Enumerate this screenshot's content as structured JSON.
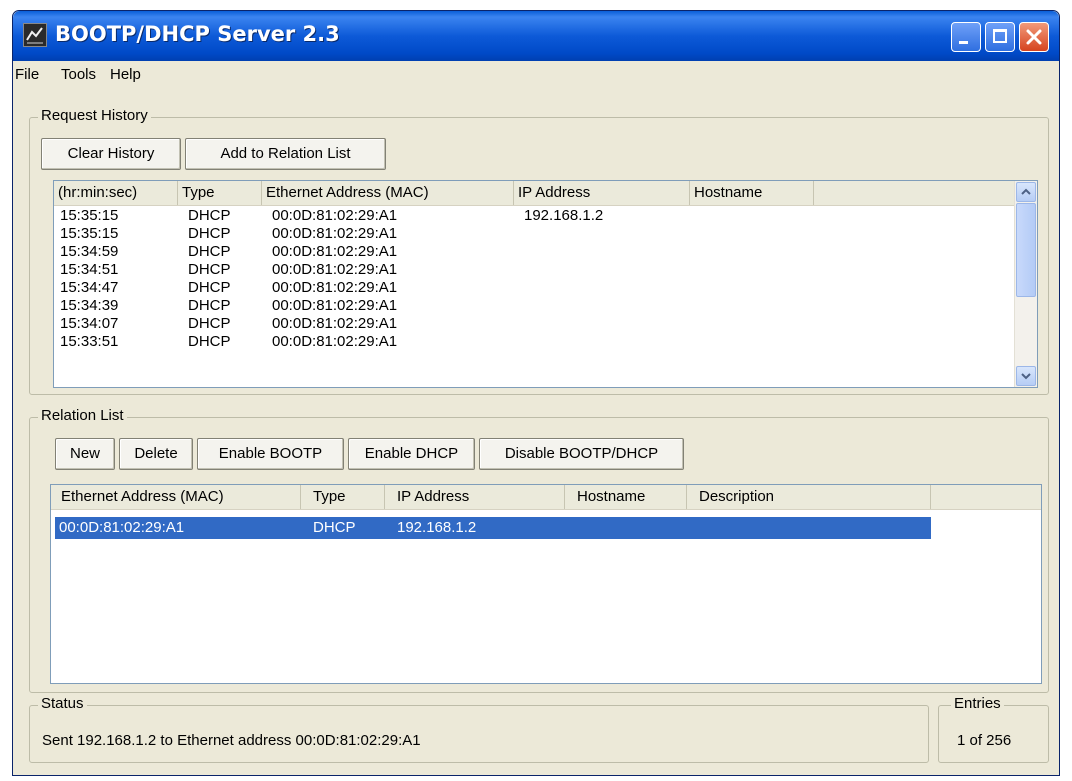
{
  "window": {
    "title": "BOOTP/DHCP Server 2.3"
  },
  "menu": [
    "File",
    "Tools",
    "Help"
  ],
  "request_history": {
    "label": "Request History",
    "buttons": {
      "clear": "Clear History",
      "add": "Add to Relation List"
    },
    "columns": [
      "(hr:min:sec)",
      "Type",
      "Ethernet Address (MAC)",
      "IP Address",
      "Hostname"
    ],
    "rows": [
      {
        "time": "15:35:15",
        "type": "DHCP",
        "mac": "00:0D:81:02:29:A1",
        "ip": "192.168.1.2",
        "host": ""
      },
      {
        "time": "15:35:15",
        "type": "DHCP",
        "mac": "00:0D:81:02:29:A1",
        "ip": "",
        "host": ""
      },
      {
        "time": "15:34:59",
        "type": "DHCP",
        "mac": "00:0D:81:02:29:A1",
        "ip": "",
        "host": ""
      },
      {
        "time": "15:34:51",
        "type": "DHCP",
        "mac": "00:0D:81:02:29:A1",
        "ip": "",
        "host": ""
      },
      {
        "time": "15:34:47",
        "type": "DHCP",
        "mac": "00:0D:81:02:29:A1",
        "ip": "",
        "host": ""
      },
      {
        "time": "15:34:39",
        "type": "DHCP",
        "mac": "00:0D:81:02:29:A1",
        "ip": "",
        "host": ""
      },
      {
        "time": "15:34:07",
        "type": "DHCP",
        "mac": "00:0D:81:02:29:A1",
        "ip": "",
        "host": ""
      },
      {
        "time": "15:33:51",
        "type": "DHCP",
        "mac": "00:0D:81:02:29:A1",
        "ip": "",
        "host": ""
      }
    ]
  },
  "relation_list": {
    "label": "Relation List",
    "buttons": {
      "new": "New",
      "delete": "Delete",
      "enable_bootp": "Enable BOOTP",
      "enable_dhcp": "Enable DHCP",
      "disable": "Disable BOOTP/DHCP"
    },
    "columns": [
      "Ethernet Address (MAC)",
      "Type",
      "IP Address",
      "Hostname",
      "Description"
    ],
    "rows": [
      {
        "mac": "00:0D:81:02:29:A1",
        "type": "DHCP",
        "ip": "192.168.1.2",
        "host": "",
        "desc": "",
        "selected": true
      }
    ]
  },
  "status": {
    "label": "Status",
    "text": "Sent 192.168.1.2 to Ethernet address 00:0D:81:02:29:A1"
  },
  "entries": {
    "label": "Entries",
    "text": "1 of 256"
  },
  "colors": {
    "title_bar": "#0d5ad8",
    "window_face": "#ece9d8",
    "selection": "#316ac5"
  }
}
